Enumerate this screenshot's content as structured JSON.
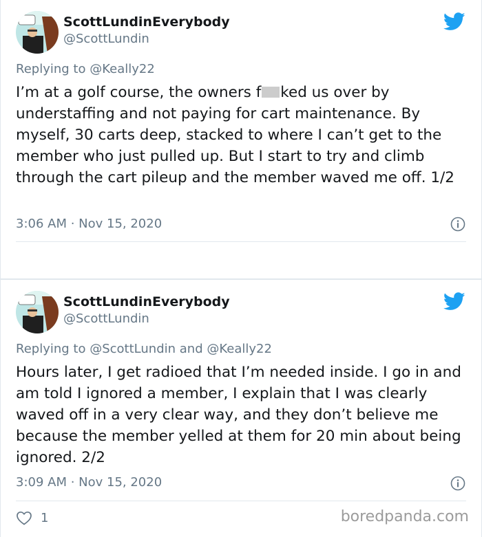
{
  "tweets": [
    {
      "author_name": "ScottLundinEverybody",
      "author_handle": "@ScottLundin",
      "replying_label": "Replying to",
      "replying_to": [
        {
          "handle": "@Keally22"
        }
      ],
      "text_before_redaction": "I’m at a golf course, the owners f",
      "text_after_redaction": "ked us over by understaffing and not paying for cart maintenance. By myself, 30 carts deep, stacked to where I can’t get to the member who just pulled up. But I start to try and climb through the cart pileup and the member waved me off. 1/2",
      "timestamp": "3:06 AM · Nov 15, 2020"
    },
    {
      "author_name": "ScottLundinEverybody",
      "author_handle": "@ScottLundin",
      "replying_label": "Replying to",
      "replying_to": [
        {
          "handle": "@ScottLundin"
        },
        {
          "handle": "@Keally22"
        }
      ],
      "replying_joiner": "and",
      "text": "Hours later, I get radioed that I’m needed inside. I go in and am told I ignored a member, I explain that I was clearly waved off in a very clear way, and they don’t believe me because the member yelled at them for 20 min about being ignored. 2/2",
      "timestamp": "3:09 AM · Nov 15, 2020",
      "like_count": "1"
    }
  ],
  "watermark": "boredpanda.com",
  "colors": {
    "twitter_blue": "#1da1f2",
    "text_primary": "#14171a",
    "text_secondary": "#657786",
    "divider": "#e1e8ed"
  },
  "icons": {
    "brand": "twitter-bird-icon",
    "info": "info-icon",
    "like": "heart-outline-icon"
  }
}
